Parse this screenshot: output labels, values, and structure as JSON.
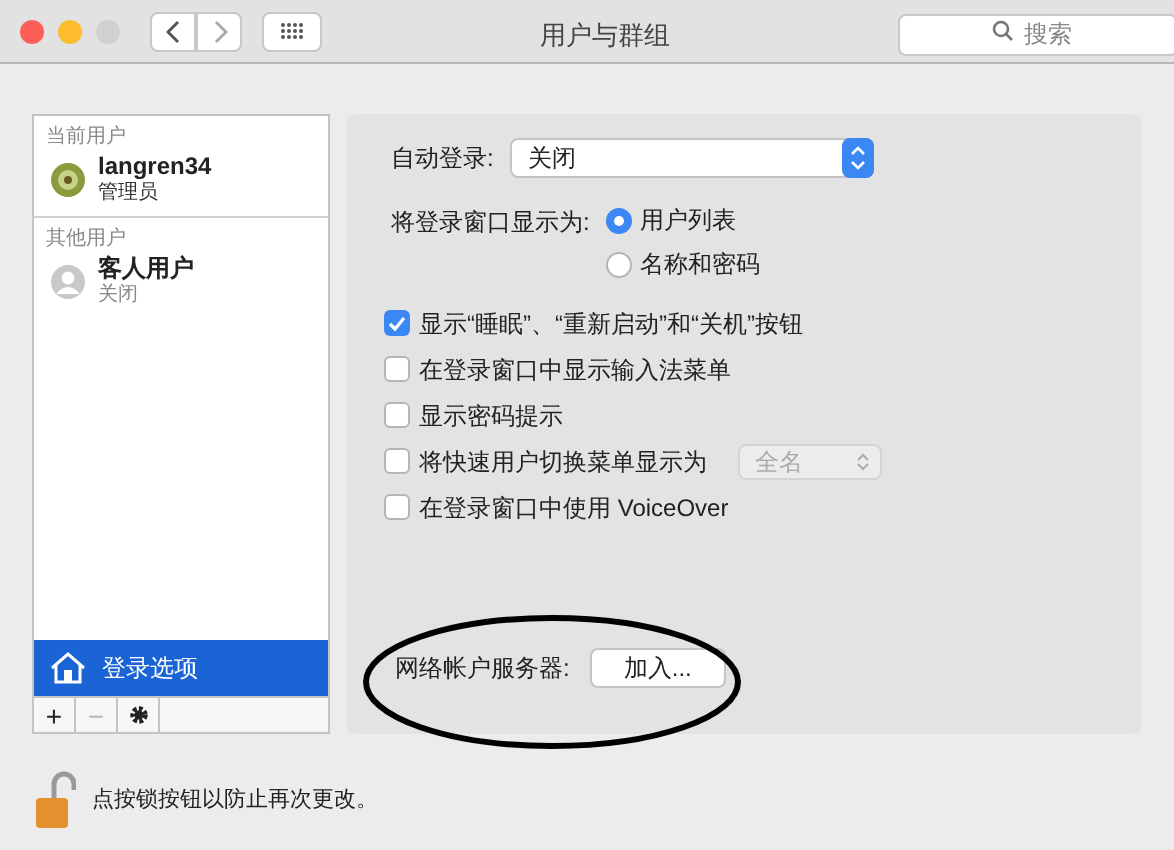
{
  "window": {
    "title": "用户与群组",
    "search_placeholder": "搜索"
  },
  "sidebar": {
    "sections": [
      {
        "heading": "当前用户",
        "users": [
          {
            "name": "langren34",
            "role": "管理员",
            "kind": "admin",
            "selected": false
          }
        ]
      },
      {
        "heading": "其他用户",
        "users": [
          {
            "name": "客人用户",
            "role": "关闭",
            "kind": "guest",
            "selected": false
          }
        ]
      }
    ],
    "login_options": {
      "label": "登录选项",
      "selected": true
    },
    "buttons": [
      {
        "kind": "add",
        "label": "+",
        "disabled": false
      },
      {
        "kind": "remove",
        "label": "−",
        "disabled": true
      },
      {
        "kind": "gear",
        "disabled": false
      }
    ]
  },
  "settings": {
    "auto_login": {
      "label": "自动登录:",
      "value": "关闭"
    },
    "login_window": {
      "label": "将登录窗口显示为:",
      "options": [
        {
          "label": "用户列表",
          "selected": true
        },
        {
          "label": "名称和密码",
          "selected": false
        }
      ]
    },
    "checkboxes": [
      {
        "label": "显示“睡眠”、“重新启动”和“关机”按钮",
        "checked": true
      },
      {
        "label": "在登录窗口中显示输入法菜单",
        "checked": false
      },
      {
        "label": "显示密码提示",
        "checked": false
      },
      {
        "label": "将快速用户切换菜单显示为",
        "checked": false,
        "select": {
          "value": "全名",
          "disabled": true
        }
      },
      {
        "label": "在登录窗口中使用 VoiceOver",
        "checked": false
      }
    ],
    "network_server": {
      "label": "网络帐户服务器:",
      "button": "加入..."
    }
  },
  "footer": {
    "lock_text": "点按锁按钮以防止再次更改。",
    "locked": false
  }
}
